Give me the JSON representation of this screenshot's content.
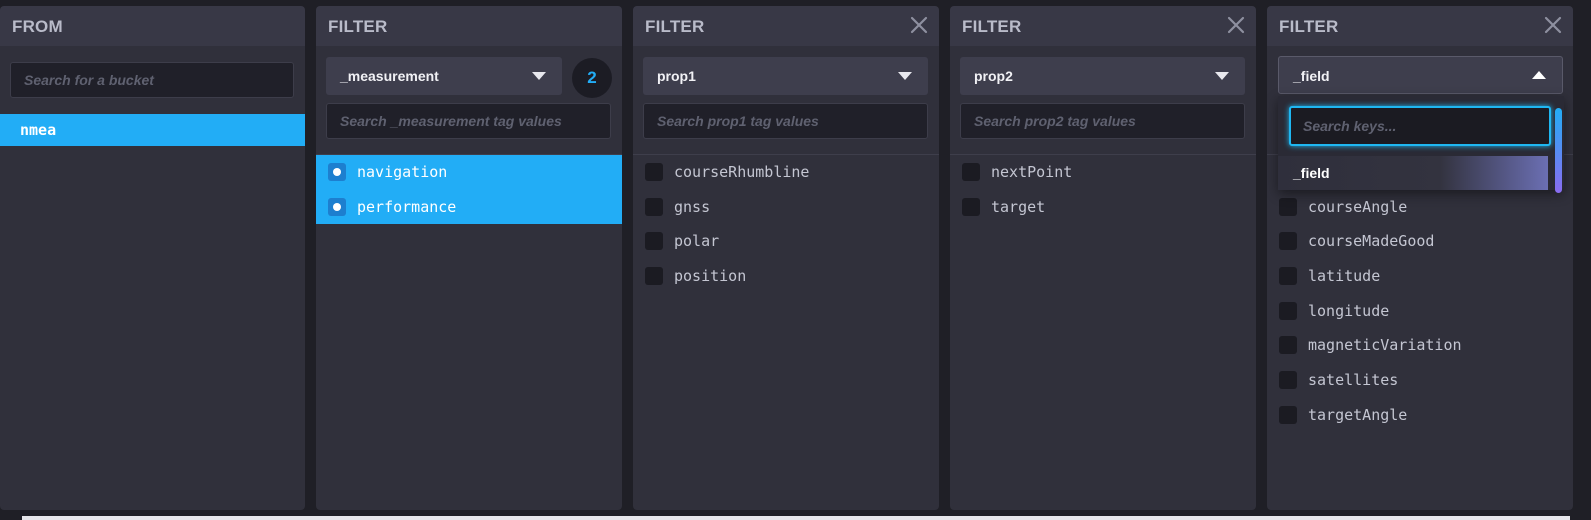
{
  "cards": {
    "from": {
      "title": "FROM",
      "search_placeholder": "Search for a bucket",
      "buckets": [
        "nmea"
      ]
    },
    "measurement": {
      "title": "FILTER",
      "key": "_measurement",
      "selected_count": "2",
      "search_placeholder": "Search _measurement tag values",
      "items": [
        {
          "label": "navigation",
          "checked": true
        },
        {
          "label": "performance",
          "checked": true
        }
      ]
    },
    "prop1": {
      "title": "FILTER",
      "key": "prop1",
      "search_placeholder": "Search prop1 tag values",
      "items": [
        {
          "label": "courseRhumbline",
          "checked": false
        },
        {
          "label": "gnss",
          "checked": false
        },
        {
          "label": "polar",
          "checked": false
        },
        {
          "label": "position",
          "checked": false
        }
      ]
    },
    "prop2": {
      "title": "FILTER",
      "key": "prop2",
      "search_placeholder": "Search prop2 tag values",
      "items": [
        {
          "label": "nextPoint",
          "checked": false
        },
        {
          "label": "target",
          "checked": false
        }
      ]
    },
    "field": {
      "title": "FILTER",
      "key": "_field",
      "dropdown_open": true,
      "keys_search_placeholder": "Search keys...",
      "key_options": [
        "_field"
      ],
      "items": [
        {
          "label": "courseAngle",
          "checked": false
        },
        {
          "label": "courseMadeGood",
          "checked": false
        },
        {
          "label": "latitude",
          "checked": false
        },
        {
          "label": "longitude",
          "checked": false
        },
        {
          "label": "magneticVariation",
          "checked": false
        },
        {
          "label": "satellites",
          "checked": false
        },
        {
          "label": "targetAngle",
          "checked": false
        }
      ]
    }
  },
  "icons": {
    "close": "close-icon",
    "dropdown_closed": "caret-down-icon",
    "dropdown_open": "caret-up-icon"
  },
  "colors": {
    "accent": "#22adf6",
    "card_bg": "#30303b",
    "header_bg": "#383846",
    "page_bg": "#1f1f26",
    "focus_ring": "#1fb7f2"
  }
}
